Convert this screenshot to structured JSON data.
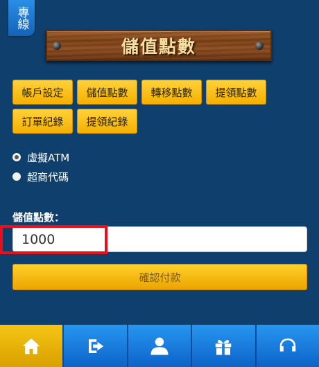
{
  "hotline_tab": {
    "label": "專線"
  },
  "header": {
    "title": "儲值點數"
  },
  "tabs": {
    "row1": [
      "帳戶設定",
      "儲值點數",
      "轉移點數",
      "提領點數"
    ],
    "row2": [
      "訂單紀錄",
      "提領紀錄"
    ]
  },
  "payment_methods": {
    "options": [
      {
        "label": "虛擬ATM",
        "checked": true
      },
      {
        "label": "超商代碼",
        "checked": false
      }
    ]
  },
  "amount": {
    "label": "儲值點數：",
    "value": "1000"
  },
  "confirm": {
    "label": "確認付款"
  },
  "bottom_nav": {
    "items": [
      {
        "icon": "home-icon",
        "active": true
      },
      {
        "icon": "logout-icon",
        "active": false
      },
      {
        "icon": "user-icon",
        "active": false
      },
      {
        "icon": "gift-icon",
        "active": false
      },
      {
        "icon": "headset-icon",
        "active": false
      }
    ]
  },
  "colors": {
    "background": "#0f3f6c",
    "accent_yellow": "#f4b000",
    "nav_blue": "#1a7fe0",
    "highlight_red": "#e8101a"
  }
}
